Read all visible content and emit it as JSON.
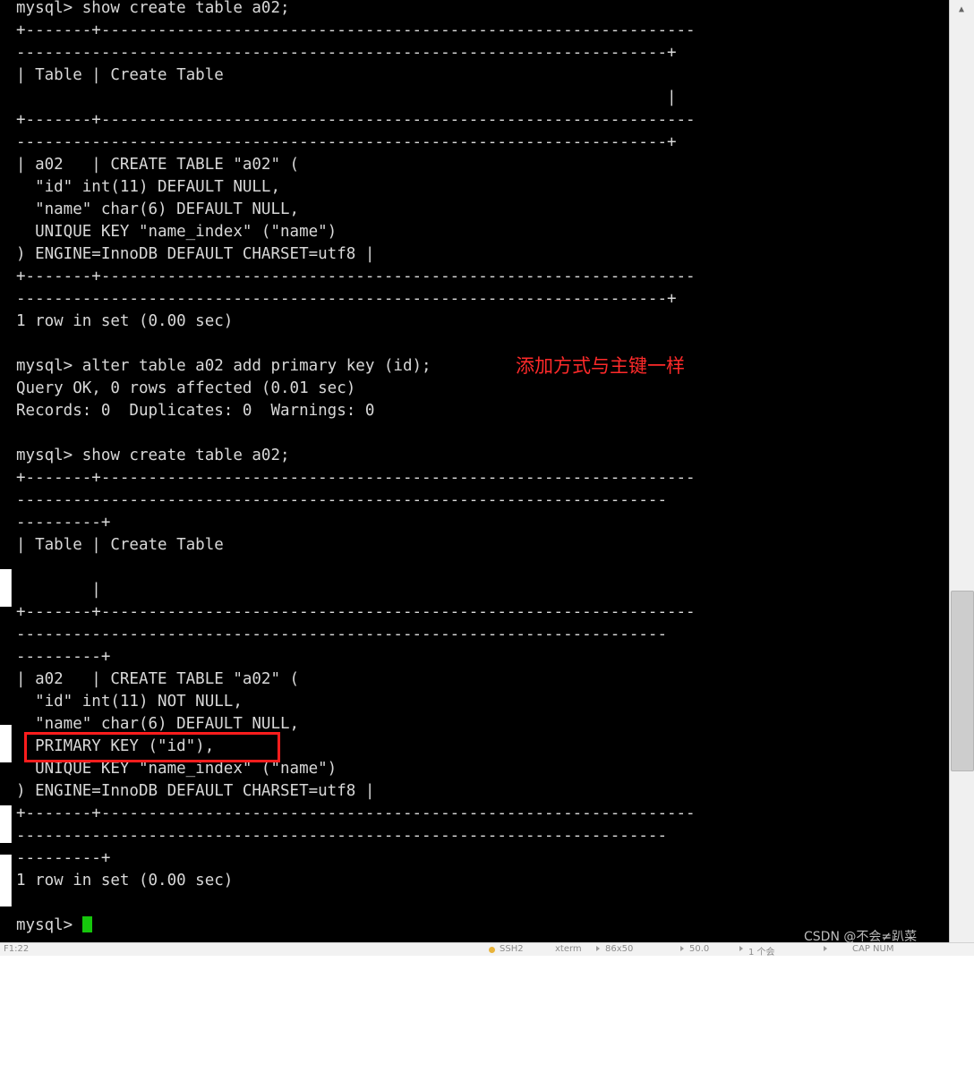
{
  "terminal": {
    "prompt": "mysql>",
    "lines": [
      "mysql> show create table a02;",
      "+-------+---------------------------------------------------------------",
      "---------------------------------------------------------------------+",
      "| Table | Create Table",
      "                                                                     |",
      "+-------+---------------------------------------------------------------",
      "---------------------------------------------------------------------+",
      "| a02   | CREATE TABLE \"a02\" (",
      "  \"id\" int(11) DEFAULT NULL,",
      "  \"name\" char(6) DEFAULT NULL,",
      "  UNIQUE KEY \"name_index\" (\"name\")",
      ") ENGINE=InnoDB DEFAULT CHARSET=utf8 |",
      "+-------+---------------------------------------------------------------",
      "---------------------------------------------------------------------+",
      "1 row in set (0.00 sec)",
      "",
      "mysql> alter table a02 add primary key (id);",
      "Query OK, 0 rows affected (0.01 sec)",
      "Records: 0  Duplicates: 0  Warnings: 0",
      "",
      "mysql> show create table a02;",
      "+-------+---------------------------------------------------------------",
      "---------------------------------------------------------------------",
      "---------+",
      "| Table | Create Table",
      "",
      "        |",
      "+-------+---------------------------------------------------------------",
      "---------------------------------------------------------------------",
      "---------+",
      "| a02   | CREATE TABLE \"a02\" (",
      "  \"id\" int(11) NOT NULL,",
      "  \"name\" char(6) DEFAULT NULL,",
      "  PRIMARY KEY (\"id\"),",
      "  UNIQUE KEY \"name_index\" (\"name\")",
      ") ENGINE=InnoDB DEFAULT CHARSET=utf8 |",
      "+-------+---------------------------------------------------------------",
      "---------------------------------------------------------------------",
      "---------+",
      "1 row in set (0.00 sec)",
      "",
      "mysql> "
    ]
  },
  "annotations": {
    "note_text": "添加方式与主键一样",
    "note_color": "#ff2a2a",
    "highlight_color": "#ff1d1d",
    "highlight_target": "PRIMARY KEY (\"id\"),"
  },
  "watermark": {
    "text": "CSDN @不会≠趴菜"
  },
  "statusbar": {
    "left": "F1:22",
    "session": "SSH2",
    "term": "xterm",
    "size": "86x50",
    "zoom": "50.0",
    "users": "1 个会",
    "caps": "CAP NUM",
    "indicator_color": "#e8b33a"
  },
  "scrollbar": {
    "up_arrow": "▲"
  }
}
